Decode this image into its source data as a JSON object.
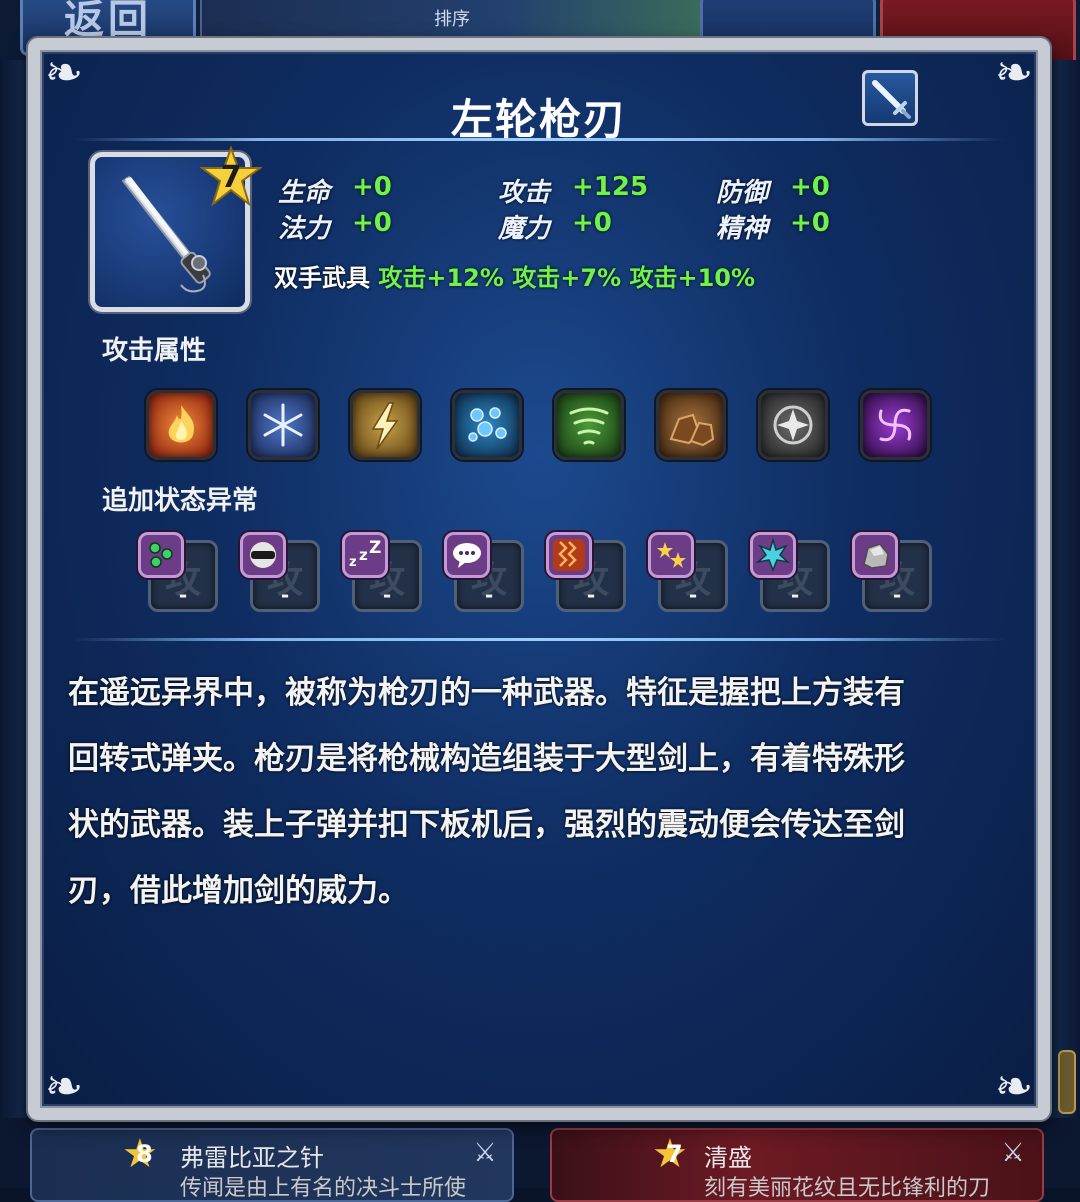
{
  "background": {
    "back_label": "返回",
    "sort_label": "排序",
    "cards": [
      {
        "rank": "8",
        "name": "弗雷比亚之针",
        "desc": "传闻是由上有名的决斗士所使"
      },
      {
        "rank": "7",
        "name": "清盛",
        "desc": "刻有美丽花纹且无比锋利的刀"
      }
    ]
  },
  "dialog": {
    "title": "左轮枪刃",
    "weapon_type_icon": "sword-icon",
    "rank": "7",
    "stats": [
      {
        "label": "生命",
        "value": "+0"
      },
      {
        "label": "攻击",
        "value": "+125"
      },
      {
        "label": "防御",
        "value": "+0"
      },
      {
        "label": "法力",
        "value": "+0"
      },
      {
        "label": "魔力",
        "value": "+0"
      },
      {
        "label": "精神",
        "value": "+0"
      }
    ],
    "weapon_class": "双手武具",
    "bonuses": "攻击+12% 攻击+7% 攻击+10%",
    "attack_attr_title": "攻击属性",
    "elements": [
      {
        "icon": "fire-icon",
        "color": "#c23a1a"
      },
      {
        "icon": "ice-icon",
        "color": "#3a5fa8"
      },
      {
        "icon": "thunder-icon",
        "color": "#b08a3a"
      },
      {
        "icon": "water-icon",
        "color": "#2b6f9e"
      },
      {
        "icon": "wind-icon",
        "color": "#3f8a3a"
      },
      {
        "icon": "earth-icon",
        "color": "#8a5a2a"
      },
      {
        "icon": "holy-icon",
        "color": "#6b6b6b"
      },
      {
        "icon": "dark-icon",
        "color": "#7a2a9a"
      }
    ],
    "status_title": "追加状态异常",
    "status_ghost": "攻",
    "statuses": [
      {
        "icon": "poison-icon",
        "value": "-"
      },
      {
        "icon": "blind-icon",
        "value": "-"
      },
      {
        "icon": "sleep-icon",
        "value": "-"
      },
      {
        "icon": "silence-icon",
        "value": "-"
      },
      {
        "icon": "paralyze-icon",
        "value": "-"
      },
      {
        "icon": "confuse-icon",
        "value": "-"
      },
      {
        "icon": "disease-icon",
        "value": "-"
      },
      {
        "icon": "petrify-icon",
        "value": "-"
      }
    ],
    "description_lines": [
      "在遥远异界中，被称为枪刃的一种武器。特征是握把上方装有",
      "回转式弹夹。枪刃是将枪械构造组装于大型剑上，有着特殊形",
      "状的武器。装上子弹并扣下板机后，强烈的震动便会传达至剑",
      "刃，借此增加剑的威力。"
    ]
  },
  "colors": {
    "stat_value": "#6ef34a",
    "panel_bg": "#0f2d62",
    "frame": "#c7ccd4"
  }
}
